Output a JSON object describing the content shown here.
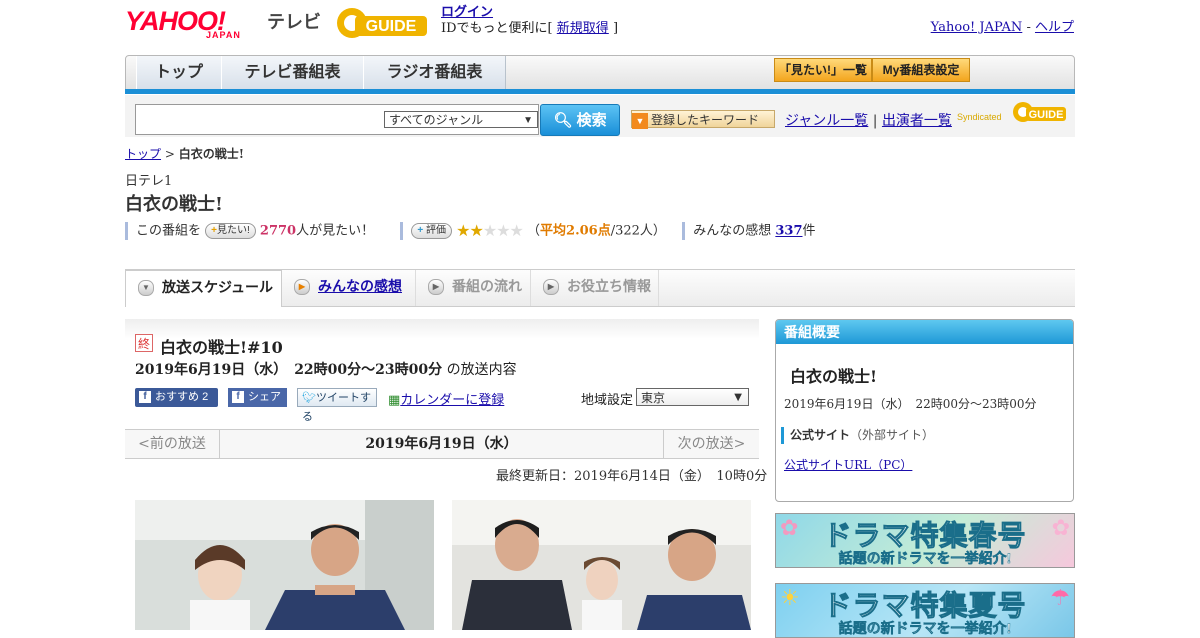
{
  "header": {
    "logo_yahoo": "YAHOO!",
    "logo_japan": "JAPAN",
    "logo_tv": "テレビ",
    "logo_guide": "GUIDE",
    "login": "ログイン",
    "login_sub_prefix": "IDでもっと便利に[",
    "login_sub_link": "新規取得",
    "login_sub_suffix": "]",
    "yahoo_japan_link": "Yahoo! JAPAN",
    "separator": "-",
    "help_link": "ヘルプ"
  },
  "nav": {
    "tabs": [
      "トップ",
      "テレビ番組表",
      "ラジオ番組表"
    ],
    "want_list": "「見たい!」一覧",
    "my_schedule": "My番組表設定"
  },
  "search": {
    "genre": "すべてのジャンル",
    "button": "検索",
    "keyword_button": "登録したキーワード",
    "genre_list": "ジャンル一覧",
    "divider": "|",
    "cast_list": "出演者一覧",
    "syndicated": "Syndicated",
    "syndicated_logo": "GUIDE"
  },
  "breadcrumb": {
    "top": "トップ",
    "sep": ">",
    "current": "白衣の戦士!"
  },
  "program": {
    "channel": "日テレ1",
    "title": "白衣の戦士!",
    "want_prefix": "この番組を",
    "want_button": "見たい!",
    "want_count": "2770",
    "want_suffix": "人が見たい！",
    "rate_button": "評価",
    "rating_avg_prefix": "（",
    "rating_avg_label": "平均2.06点",
    "rating_avg_suffix": "/322人）",
    "rating_value": 2.06,
    "rating_max": 5,
    "impressions_prefix": "みんなの感想",
    "impressions_count": "337",
    "impressions_suffix": "件"
  },
  "tabs": {
    "schedule": "放送スケジュール",
    "impressions": "みんなの感想",
    "flow": "番組の流れ",
    "info": "お役立ち情報"
  },
  "episode": {
    "end_badge": "終",
    "title": "白衣の戦士!#10",
    "date_time": "2019年6月19日（水）　22時00分～23時00分",
    "date_suffix": "の放送内容",
    "recommend": "おすすめ",
    "recommend_count": "2",
    "share": "シェア",
    "tweet": "ツイートする",
    "calendar": "カレンダーに登録",
    "region_label": "地域設定",
    "region_value": "東京",
    "prev": "<前の放送",
    "current_date": "2019年6月19日（水）",
    "next": "次の放送>",
    "updated": "最終更新日：2019年6月14日（金）　10時0分"
  },
  "overview": {
    "heading": "番組概要",
    "title": "白衣の戦士!",
    "time": "2019年6月19日（水）　22時00分～23時00分",
    "official_label": "公式サイト",
    "official_note": "（外部サイト）",
    "official_link": "公式サイトURL（PC）"
  },
  "banners": [
    {
      "title": "ドラマ特集春号",
      "sub": "話題の新ドラマを一挙紹介!"
    },
    {
      "title": "ドラマ特集夏号",
      "sub": "話題の新ドラマを一挙紹介!"
    }
  ],
  "colors": {
    "accent_blue": "#1b8fd6",
    "yahoo_red": "#ff0033",
    "guide_yellow": "#f0b400"
  }
}
